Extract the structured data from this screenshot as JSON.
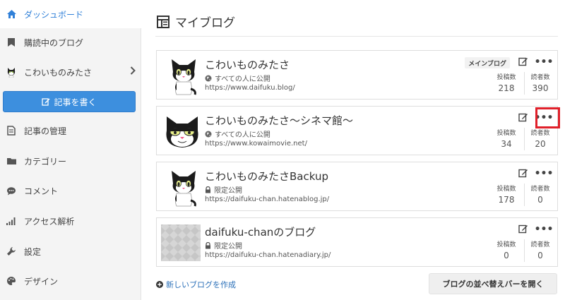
{
  "sidebar": {
    "items": [
      {
        "label": "ダッシュボード",
        "icon": "home-icon"
      },
      {
        "label": "購読中のブログ",
        "icon": "bookmark-icon"
      },
      {
        "label": "こわいものみたさ",
        "icon": "cat-avatar-icon"
      },
      {
        "label": "記事の管理",
        "icon": "document-icon"
      },
      {
        "label": "カテゴリー",
        "icon": "folder-icon"
      },
      {
        "label": "コメント",
        "icon": "comment-icon"
      },
      {
        "label": "アクセス解析",
        "icon": "bar-chart-icon"
      },
      {
        "label": "設定",
        "icon": "wrench-icon"
      },
      {
        "label": "デザイン",
        "icon": "palette-icon"
      }
    ],
    "write_button": "記事を書く"
  },
  "main": {
    "title": "マイブログ",
    "blogs": [
      {
        "name": "こわいものみたさ",
        "visibility": "すべての人に公開",
        "url": "https://www.daifuku.blog/",
        "badge": "メインブログ",
        "posts_label": "投稿数",
        "posts": "218",
        "readers_label": "読者数",
        "readers": "390"
      },
      {
        "name": "こわいものみたさ～シネマ館～",
        "visibility": "すべての人に公開",
        "url": "https://www.kowaimovie.net/",
        "posts_label": "投稿数",
        "posts": "34",
        "readers_label": "読者数",
        "readers": "20"
      },
      {
        "name": "こわいものみたさBackup",
        "visibility": "限定公開",
        "url": "https://daifuku-chan.hatenablog.jp/",
        "posts_label": "投稿数",
        "posts": "178",
        "readers_label": "読者数",
        "readers": "0"
      },
      {
        "name": "daifuku-chanのブログ",
        "visibility": "限定公開",
        "url": "https://daifuku-chan.hatenadiary.jp/",
        "posts_label": "投稿数",
        "posts": "0",
        "readers_label": "読者数",
        "readers": "0"
      }
    ],
    "new_blog_link": "新しいブログを作成",
    "reorder_button": "ブログの並べ替えバーを開く"
  },
  "colors": {
    "accent": "#3d8fde",
    "highlight": "#e0202a"
  }
}
